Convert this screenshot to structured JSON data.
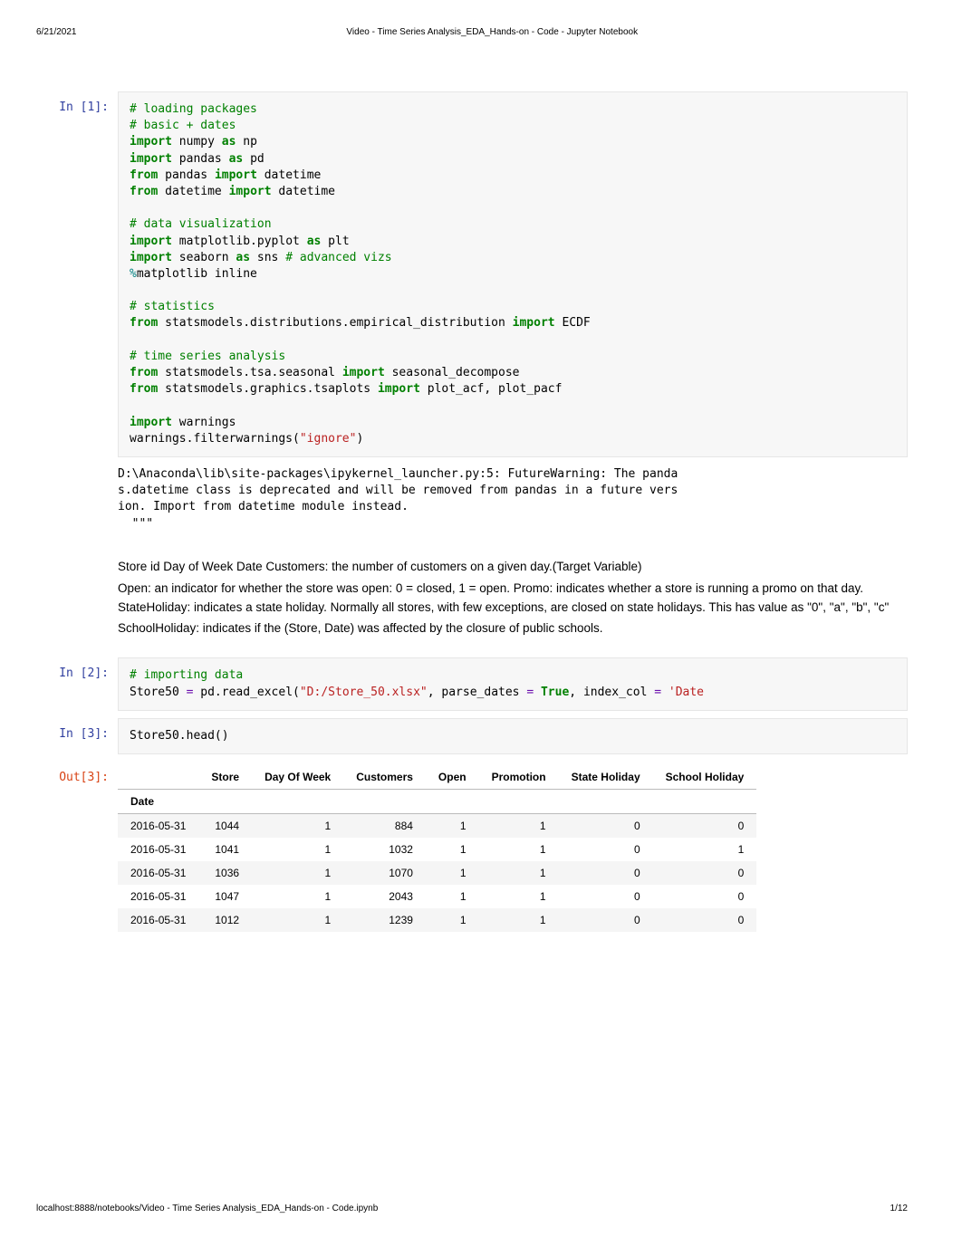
{
  "header": {
    "date": "6/21/2021",
    "title": "Video - Time Series Analysis_EDA_Hands-on - Code - Jupyter Notebook"
  },
  "prompts": {
    "in1": "In [1]:",
    "in2": "In [2]:",
    "in3": "In [3]:",
    "out3": "Out[3]:"
  },
  "cell1": {
    "c_loading": "# loading packages",
    "c_basic": "# basic + dates",
    "kw_import1": "import",
    "np_mod": " numpy ",
    "kw_as1": "as",
    "np_alias": " np",
    "kw_import2": "import",
    "pd_mod": " pandas ",
    "kw_as2": "as",
    "pd_alias": " pd",
    "kw_from1": "from",
    "pandas_mod": " pandas ",
    "kw_import3": "import",
    "datetime1": " datetime",
    "kw_from2": "from",
    "datetime_mod": " datetime ",
    "kw_import4": "import",
    "datetime2": " datetime",
    "c_viz": "# data visualization",
    "kw_import5": "import",
    "mpl_mod": " matplotlib.pyplot ",
    "kw_as3": "as",
    "plt_alias": " plt",
    "kw_import6": "import",
    "sns_mod": " seaborn ",
    "kw_as4": "as",
    "sns_alias": " sns ",
    "c_adv": "# advanced vizs",
    "magic": "%",
    "magic_body": "matplotlib inline",
    "c_stats": "# statistics",
    "kw_from3": "from",
    "sm_dist_mod": " statsmodels.distributions.empirical_distribution ",
    "kw_import7": "import",
    "ecdf": " ECDF",
    "c_tsa": "# time series analysis",
    "kw_from4": "from",
    "sm_seasonal_mod": " statsmodels.tsa.seasonal ",
    "kw_import8": "import",
    "sd": " seasonal_decompose",
    "kw_from5": "from",
    "sm_tsaplots_mod": " statsmodels.graphics.tsaplots ",
    "kw_import9": "import",
    "acf": " plot_acf, plot_pacf",
    "kw_import10": "import",
    "warn_mod": " warnings",
    "warn_call": "warnings.filterwarnings(",
    "ignore": "\"ignore\"",
    "close": ")"
  },
  "cell1_out": "D:\\Anaconda\\lib\\site-packages\\ipykernel_launcher.py:5: FutureWarning: The panda\ns.datetime class is deprecated and will be removed from pandas in a future vers\nion. Import from datetime module instead.\n  \"\"\"",
  "markdown": {
    "p1": "Store id Day of Week Date Customers: the number of customers on a given day.(Target Variable)",
    "p2": "Open: an indicator for whether the store was open: 0 = closed, 1 = open. Promo: indicates whether a store is running a promo on that day. StateHoliday: indicates a state holiday. Normally all stores, with few exceptions, are closed on state holidays. This has value as \"0\", \"a\", \"b\", \"c\"",
    "p3": "SchoolHoliday: indicates if the (Store, Date) was affected by the closure of public schools."
  },
  "cell2": {
    "c_import": "# importing data",
    "var": "Store50 ",
    "eq": "=",
    "read": " pd.read_excel(",
    "file": "\"D:/Store_50.xlsx\"",
    "sep": ", parse_dates ",
    "eq2": "=",
    "true": " True",
    "sep2": ", index_col ",
    "eq3": "=",
    "date": " 'Date"
  },
  "cell3": {
    "code": "Store50.head()"
  },
  "chart_data": {
    "type": "table",
    "index_name": "Date",
    "columns": [
      "Store",
      "Day Of Week",
      "Customers",
      "Open",
      "Promotion",
      "State Holiday",
      "School Holiday"
    ],
    "index": [
      "2016-05-31",
      "2016-05-31",
      "2016-05-31",
      "2016-05-31",
      "2016-05-31"
    ],
    "rows": [
      [
        1044,
        1,
        884,
        1,
        1,
        0,
        0
      ],
      [
        1041,
        1,
        1032,
        1,
        1,
        0,
        1
      ],
      [
        1036,
        1,
        1070,
        1,
        1,
        0,
        0
      ],
      [
        1047,
        1,
        2043,
        1,
        1,
        0,
        0
      ],
      [
        1012,
        1,
        1239,
        1,
        1,
        0,
        0
      ]
    ]
  },
  "footer": {
    "url": "localhost:8888/notebooks/Video - Time Series Analysis_EDA_Hands-on - Code.ipynb",
    "page": "1/12"
  }
}
